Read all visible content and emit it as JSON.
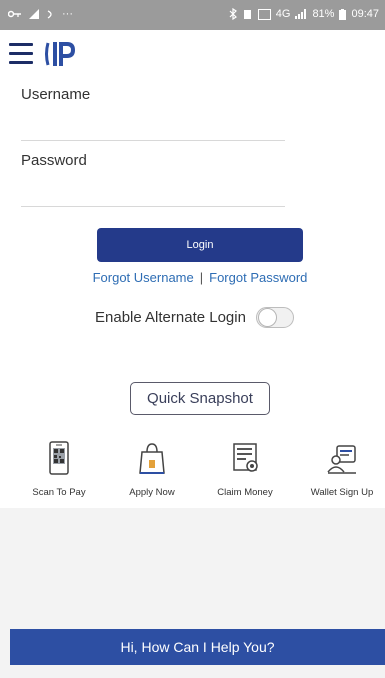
{
  "status_bar": {
    "battery": "81%",
    "time": "09:47",
    "signal_text": "4G",
    "icons": [
      "key-icon",
      "signal-icon",
      "overflow-dots-icon",
      "bluetooth-icon",
      "vibrate-icon",
      "volte-icon",
      "network-icon",
      "battery-icon"
    ]
  },
  "header": {
    "menu_icon": "hamburger-menu-icon",
    "logo_icon": "ip-logo-icon"
  },
  "form": {
    "username_label": "Username",
    "username_value": "",
    "password_label": "Password",
    "password_value": ""
  },
  "login_button": "Login",
  "forgot_username": "Forgot Username",
  "separator": "|",
  "forgot_password": "Forgot Password",
  "alternate_login": {
    "label": "Enable Alternate Login",
    "enabled": false
  },
  "quick_snapshot": "Quick Snapshot",
  "actions": [
    {
      "label": "Scan To Pay",
      "icon": "qr-phone-icon"
    },
    {
      "label": "Apply Now",
      "icon": "shopping-bag-icon"
    },
    {
      "label": "Claim Money",
      "icon": "certificate-icon"
    },
    {
      "label": "Wallet Sign Up",
      "icon": "wallet-user-icon"
    }
  ],
  "help_bar": "Hi, How Can I Help You?",
  "colors": {
    "primary": "#243a8a",
    "link": "#2e6db4",
    "help_bar": "#2d4fa3",
    "status_bar": "#9b9b9b"
  }
}
